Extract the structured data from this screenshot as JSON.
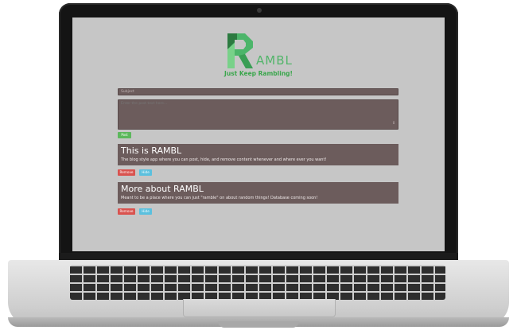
{
  "app": {
    "logo_letter": "R",
    "logo_rest": "AMBL",
    "tagline": "Just Keep Rambling!"
  },
  "form": {
    "subject_placeholder": "Subject",
    "body_placeholder": "Enter the post text here...",
    "post_button": "Post"
  },
  "posts": [
    {
      "title": "This is RAMBL",
      "text": "The blog style app where you can post, hide, and remove content whenever and where ever you want!",
      "remove_label": "Remove",
      "hide_label": "Hide"
    },
    {
      "title": "More about RAMBL",
      "text": "Meant to be a place where you can just \"ramble\" on about random things! Database coming soon!",
      "remove_label": "Remove",
      "hide_label": "Hide"
    }
  ],
  "colors": {
    "screen_bg": "#c6c6c6",
    "card_bg": "#6c5c5c",
    "brand_green": "#52b56a",
    "post_btn": "#5cb85c",
    "remove_btn": "#d9534f",
    "hide_btn": "#5bc0de"
  }
}
